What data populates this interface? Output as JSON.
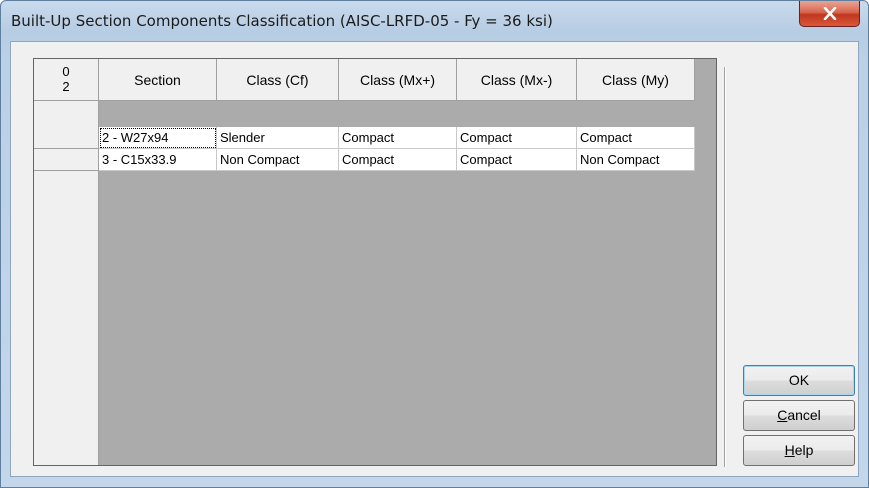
{
  "window": {
    "title": "Built-Up Section Components Classification (AISC-LRFD-05 - Fy = 36 ksi)"
  },
  "grid": {
    "corner_top": "0",
    "corner_bottom": "2",
    "columns": [
      "Section",
      "Class (Cf)",
      "Class (Mx+)",
      "Class (Mx-)",
      "Class (My)"
    ],
    "rows": [
      [
        "2 - W27x94",
        "Slender",
        "Compact",
        "Compact",
        "Compact"
      ],
      [
        "3 - C15x33.9",
        "Non Compact",
        "Compact",
        "Compact",
        "Non Compact"
      ]
    ]
  },
  "buttons": {
    "ok": "OK",
    "cancel_accel": "C",
    "cancel_rest": "ancel",
    "help_accel": "H",
    "help_rest": "elp"
  },
  "icons": {
    "close": "close-icon"
  }
}
